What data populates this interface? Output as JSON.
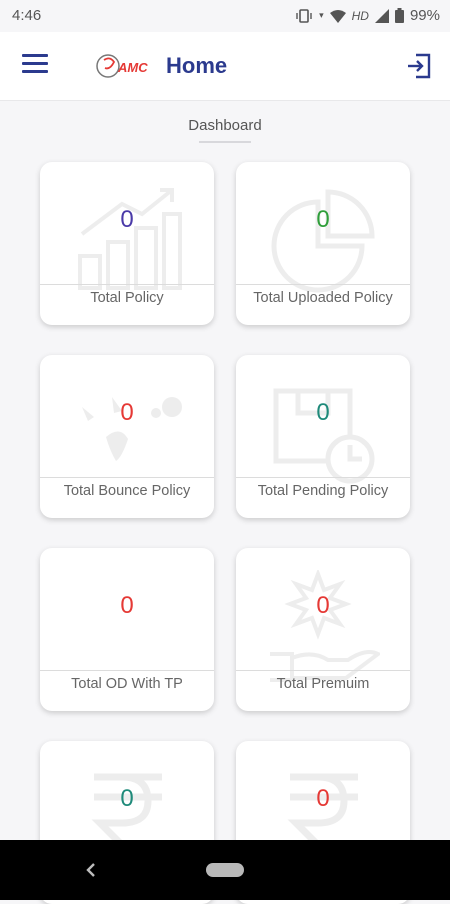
{
  "status_bar": {
    "time": "4:46",
    "network": "HD",
    "battery": "99%"
  },
  "app_bar": {
    "title": "Home",
    "logo_text": "AMC",
    "menu_icon": "hamburger-menu-icon",
    "logout_icon": "logout-icon"
  },
  "section": {
    "title": "Dashboard"
  },
  "colors": {
    "brand": "#2b3a8e",
    "purple": "#4a3aa8",
    "green": "#2f9e3a",
    "red": "#e53935",
    "teal": "#1f8a7a"
  },
  "cards": [
    {
      "value": "0",
      "label": "Total Policy",
      "icon": "bar-chart-growth-icon",
      "color": "#4a3aa8"
    },
    {
      "value": "0",
      "label": "Total Uploaded Policy",
      "icon": "pie-chart-icon",
      "color": "#2f9e3a"
    },
    {
      "value": "0",
      "label": "Total Bounce Policy",
      "icon": "bounce-icon",
      "color": "#e53935"
    },
    {
      "value": "0",
      "label": "Total Pending Policy",
      "icon": "pending-clock-icon",
      "color": "#1f8a7a"
    },
    {
      "value": "0",
      "label": "Total OD With TP",
      "icon": "blank-icon",
      "color": "#e53935"
    },
    {
      "value": "0",
      "label": "Total Premuim",
      "icon": "hand-coin-icon",
      "color": "#e53935"
    },
    {
      "value": "0",
      "label": "",
      "icon": "rupee-icon",
      "color": "#1f8a7a"
    },
    {
      "value": "0",
      "label": "",
      "icon": "rupee-icon",
      "color": "#e53935"
    }
  ]
}
